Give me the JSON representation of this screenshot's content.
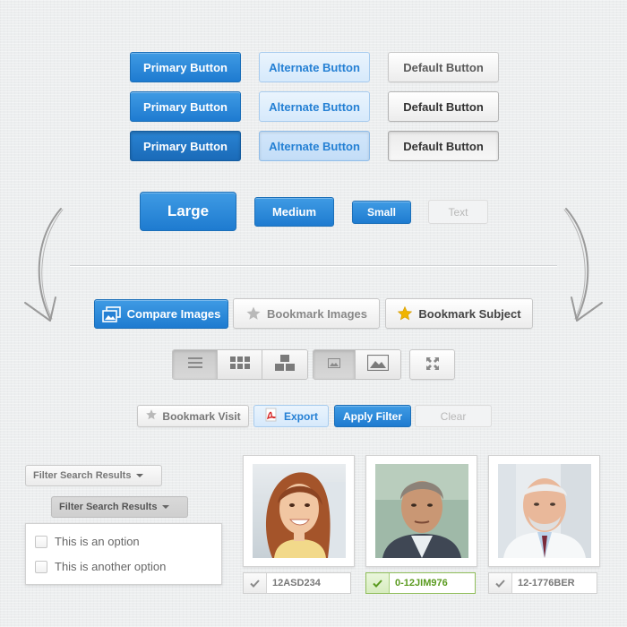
{
  "button_rows": [
    {
      "primary": "Primary Button",
      "alternate": "Alternate Button",
      "default": "Default Button"
    },
    {
      "primary": "Primary Button",
      "alternate": "Alternate Button",
      "default": "Default Button"
    },
    {
      "primary": "Primary Button",
      "alternate": "Alternate Button",
      "default": "Default Button"
    }
  ],
  "sizes": {
    "large": "Large",
    "medium": "Medium",
    "small": "Small",
    "text": "Text"
  },
  "actions": {
    "compare_images": "Compare Images",
    "bookmark_images": "Bookmark Images",
    "bookmark_subject": "Bookmark Subject"
  },
  "view_toggles": {
    "group1": [
      "list-view-icon",
      "grid-view-icon",
      "tiles-view-icon"
    ],
    "group2": [
      "small-image-icon",
      "large-image-icon"
    ],
    "fullscreen": "fullscreen-icon"
  },
  "filter_bar": {
    "bookmark_visit": "Bookmark Visit",
    "export": "Export",
    "apply_filter": "Apply Filter",
    "clear": "Clear"
  },
  "filters": {
    "dropdown_closed": "Filter Search Results",
    "dropdown_open": "Filter Search Results",
    "options": [
      "This is an option",
      "This is another option"
    ]
  },
  "subjects": [
    {
      "id": "12ASD234",
      "selected": false
    },
    {
      "id": "0-12JIM976",
      "selected": true
    },
    {
      "id": "12-1776BER",
      "selected": false
    }
  ],
  "colors": {
    "primary": "#2a88d8",
    "selected_green": "#5a9a1f",
    "star_gold": "#f0b400"
  }
}
